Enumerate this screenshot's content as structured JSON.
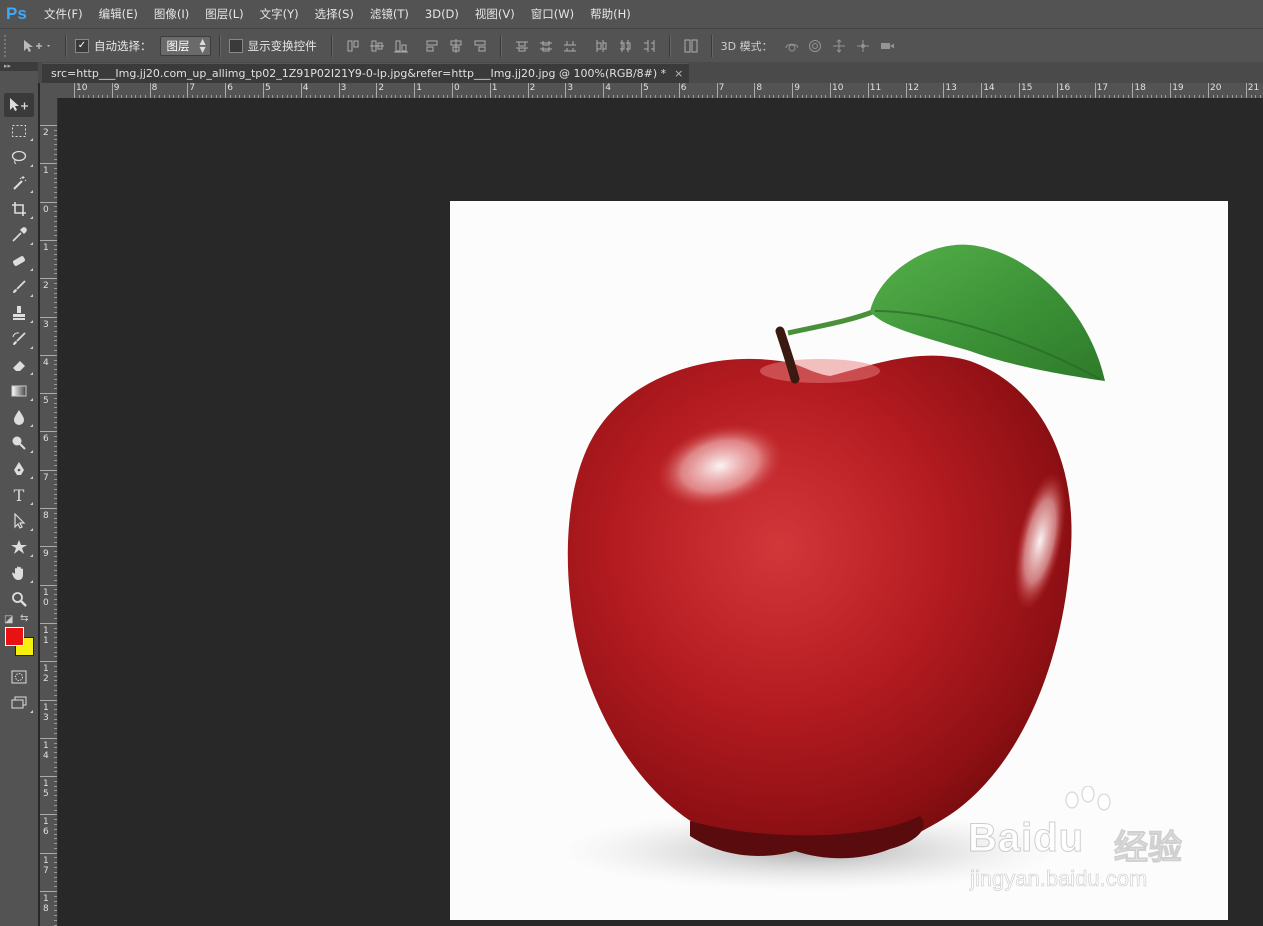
{
  "app": {
    "logo": "Ps"
  },
  "menu": [
    "文件(F)",
    "编辑(E)",
    "图像(I)",
    "图层(L)",
    "文字(Y)",
    "选择(S)",
    "滤镜(T)",
    "3D(D)",
    "视图(V)",
    "窗口(W)",
    "帮助(H)"
  ],
  "options": {
    "auto_select_label": "自动选择：",
    "auto_select_checked": true,
    "auto_select_target": "图层",
    "show_transform_label": "显示变换控件",
    "show_transform_checked": false,
    "mode_3d_label": "3D 模式："
  },
  "document": {
    "tab_title": "src=http___Img.jj20.com_up_allimg_tp02_1Z91P02I21Y9-0-lp.jpg&refer=http___Img.jj20.jpg @ 100%(RGB/8#) *",
    "close_glyph": "×"
  },
  "rulers": {
    "horizontal": [
      "10",
      "9",
      "8",
      "7",
      "6",
      "5",
      "4",
      "3",
      "2",
      "1",
      "0",
      "1",
      "2",
      "3",
      "4",
      "5",
      "6",
      "7",
      "8",
      "9",
      "10",
      "11",
      "12",
      "13",
      "14",
      "15",
      "16",
      "17",
      "18",
      "19",
      "20",
      "21"
    ],
    "vertical": [
      "2",
      "1",
      "0",
      "1",
      "2",
      "3",
      "4",
      "5",
      "6",
      "7",
      "8",
      "9",
      "10",
      "11",
      "12",
      "13",
      "14",
      "15",
      "16",
      "17",
      "18"
    ]
  },
  "colors": {
    "foreground": "#e81212",
    "background": "#f7f00e",
    "accent": "#3fa9f5"
  },
  "tools": [
    "move-tool",
    "marquee-tool",
    "lasso-tool",
    "magic-wand-tool",
    "crop-tool",
    "eyedropper-tool",
    "healing-brush-tool",
    "brush-tool",
    "clone-stamp-tool",
    "history-brush-tool",
    "eraser-tool",
    "gradient-tool",
    "blur-tool",
    "dodge-tool",
    "pen-tool",
    "type-tool",
    "path-selection-tool",
    "custom-shape-tool",
    "hand-tool",
    "zoom-tool"
  ],
  "watermark": {
    "brand": "Baidu",
    "product": "经验",
    "url": "jingyan.baidu.com"
  }
}
